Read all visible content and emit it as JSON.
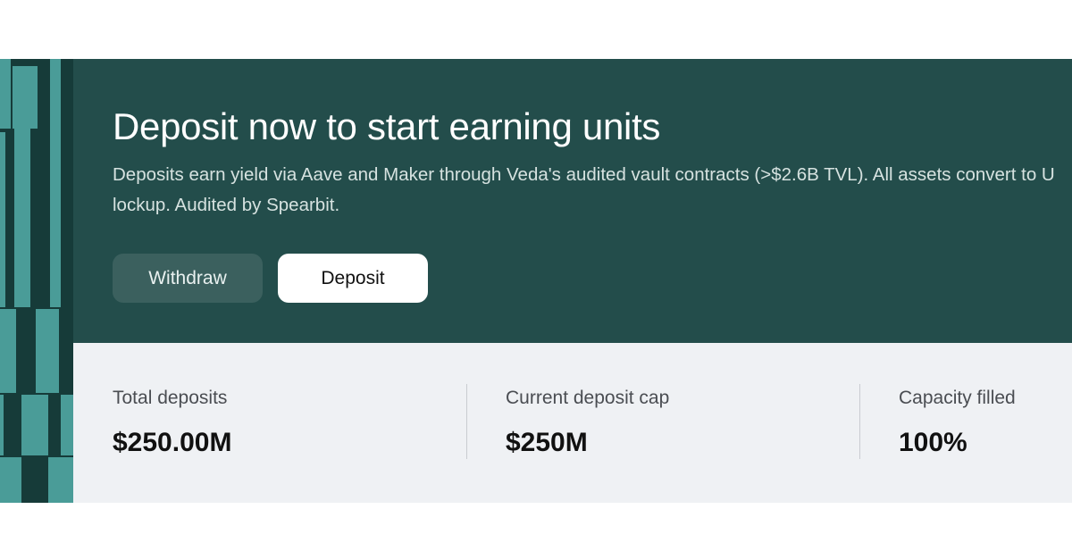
{
  "hero": {
    "title": "Deposit now to start earning units",
    "description": "Deposits earn yield via Aave and Maker through Veda's audited vault contracts (>$2.6B TVL). All assets convert to U lockup. Audited by Spearbit.",
    "withdraw_label": "Withdraw",
    "deposit_label": "Deposit"
  },
  "stats": {
    "total_deposits": {
      "label": "Total deposits",
      "value": "$250.00M"
    },
    "deposit_cap": {
      "label": "Current deposit cap",
      "value": "$250M"
    },
    "capacity": {
      "label": "Capacity filled",
      "value": "100%"
    }
  },
  "colors": {
    "hero_bg": "#234d4b",
    "stripe_dark": "#163b39",
    "stripe_light": "#4a9c98",
    "stats_bg": "#eff1f4",
    "withdraw_bg": "#3b605e"
  }
}
